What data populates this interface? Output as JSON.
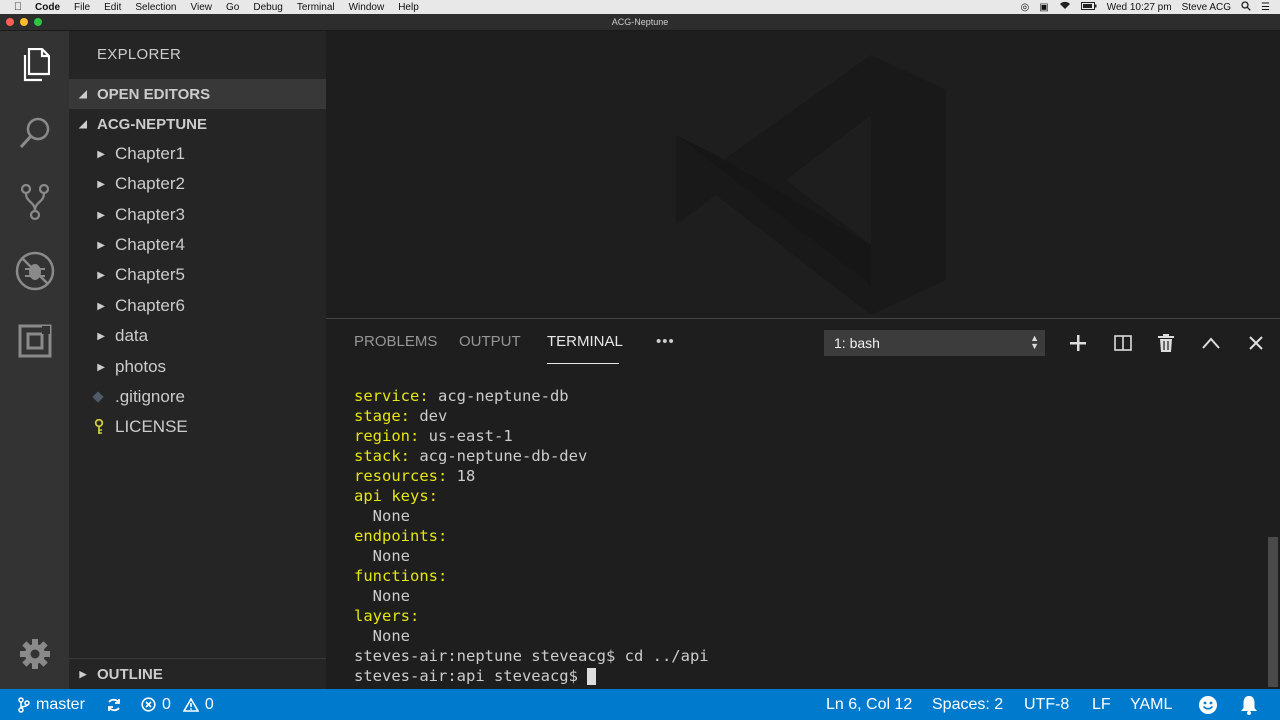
{
  "menubar": {
    "app": "Code",
    "items": [
      "File",
      "Edit",
      "Selection",
      "View",
      "Go",
      "Debug",
      "Terminal",
      "Window",
      "Help"
    ],
    "clock": "Wed 10:27 pm",
    "user": "Steve ACG"
  },
  "window": {
    "title": "ACG-Neptune"
  },
  "sidebar": {
    "title": "EXPLORER",
    "open_editors": "OPEN EDITORS",
    "project": "ACG-NEPTUNE",
    "items": [
      {
        "label": "Chapter1",
        "type": "folder"
      },
      {
        "label": "Chapter2",
        "type": "folder"
      },
      {
        "label": "Chapter3",
        "type": "folder"
      },
      {
        "label": "Chapter4",
        "type": "folder"
      },
      {
        "label": "Chapter5",
        "type": "folder"
      },
      {
        "label": "Chapter6",
        "type": "folder"
      },
      {
        "label": "data",
        "type": "folder"
      },
      {
        "label": "photos",
        "type": "folder"
      },
      {
        "label": ".gitignore",
        "type": "file"
      },
      {
        "label": "LICENSE",
        "type": "file"
      }
    ],
    "outline": "OUTLINE"
  },
  "panel": {
    "tabs": {
      "problems": "PROBLEMS",
      "output": "OUTPUT",
      "terminal": "TERMINAL"
    },
    "more": "•••",
    "terminal_select": "1: bash",
    "lines": [
      {
        "key": "service:",
        "val": " acg-neptune-db"
      },
      {
        "key": "stage:",
        "val": " dev"
      },
      {
        "key": "region:",
        "val": " us-east-1"
      },
      {
        "key": "stack:",
        "val": " acg-neptune-db-dev"
      },
      {
        "key": "resources:",
        "val": " 18"
      },
      {
        "key": "api keys:",
        "val": ""
      },
      {
        "key": "",
        "val": "  None"
      },
      {
        "key": "endpoints:",
        "val": ""
      },
      {
        "key": "",
        "val": "  None"
      },
      {
        "key": "functions:",
        "val": ""
      },
      {
        "key": "",
        "val": "  None"
      },
      {
        "key": "layers:",
        "val": ""
      },
      {
        "key": "",
        "val": "  None"
      },
      {
        "key": "",
        "val": "steves-air:neptune steveacg$ cd ../api"
      },
      {
        "key": "",
        "val": "steves-air:api steveacg$ "
      }
    ]
  },
  "statusbar": {
    "branch": "master",
    "errors": "0",
    "warnings": "0",
    "position": "Ln 6, Col 12",
    "spaces": "Spaces: 2",
    "encoding": "UTF-8",
    "eol": "LF",
    "language": "YAML"
  }
}
